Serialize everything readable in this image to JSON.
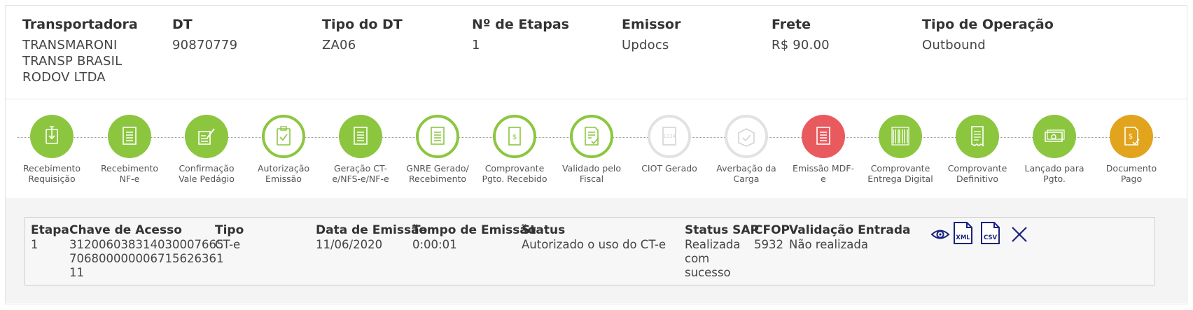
{
  "header": {
    "fields": [
      {
        "label": "Transportadora",
        "value_lines": [
          "TRANSMARONI",
          "TRANSP BRASIL",
          "RODOV LTDA"
        ]
      },
      {
        "label": "DT",
        "value_lines": [
          "90870779"
        ]
      },
      {
        "label": "Tipo do DT",
        "value_lines": [
          "ZA06"
        ]
      },
      {
        "label": "Nº de Etapas",
        "value_lines": [
          "1"
        ]
      },
      {
        "label": "Emissor",
        "value_lines": [
          "Updocs"
        ]
      },
      {
        "label": "Frete",
        "value_lines": [
          "R$ 90.00"
        ]
      },
      {
        "label": "Tipo de Operação",
        "value_lines": [
          "Outbound"
        ]
      }
    ]
  },
  "timeline": {
    "steps": [
      {
        "label1": "Recebimento",
        "label2": "Requisição",
        "state": "fill",
        "icon": "download-doc-icon"
      },
      {
        "label1": "Recebimento",
        "label2": "NF-e",
        "state": "fill",
        "icon": "document-icon"
      },
      {
        "label1": "Confirmação",
        "label2": "Vale Pedágio",
        "state": "fill",
        "icon": "sign-form-icon"
      },
      {
        "label1": "Autorização",
        "label2": "Emissão",
        "state": "outline",
        "icon": "clipboard-check-icon"
      },
      {
        "label1": "Geração CT-",
        "label2": "e/NFS-e/NF-e",
        "state": "fill",
        "icon": "document-icon"
      },
      {
        "label1": "GNRE Gerado/",
        "label2": "Recebimento",
        "state": "outline",
        "icon": "document-icon"
      },
      {
        "label1": "Comprovante",
        "label2": "Pgto. Recebido",
        "state": "outline",
        "icon": "money-doc-icon"
      },
      {
        "label1": "Validado pelo",
        "label2": "Fiscal",
        "state": "outline",
        "icon": "doc-check-icon"
      },
      {
        "label1": "CIOT Gerado",
        "label2": "",
        "state": "grey",
        "icon": "ciot-doc-icon"
      },
      {
        "label1": "Averbação da",
        "label2": "Carga",
        "state": "grey",
        "icon": "box-check-icon"
      },
      {
        "label1": "Emissão MDF-",
        "label2": "e",
        "state": "red",
        "icon": "document-icon"
      },
      {
        "label1": "Comprovante",
        "label2": "Entrega Digital",
        "state": "fill",
        "icon": "barcode-doc-icon"
      },
      {
        "label1": "Comprovante",
        "label2": "Definitivo",
        "state": "fill",
        "icon": "receipt-icon"
      },
      {
        "label1": "Lançado para",
        "label2": "Pgto.",
        "state": "fill",
        "icon": "cash-icon"
      },
      {
        "label1": "Documento",
        "label2": "Pago",
        "state": "orange",
        "icon": "paid-doc-icon"
      }
    ]
  },
  "table": {
    "headers": {
      "etapa": "Etapa",
      "chave": "Chave de Acesso",
      "tipo": "Tipo",
      "data": "Data de Emissão",
      "tempo": "Tempo de Emissão",
      "status": "Status",
      "status_sap": "Status SAP",
      "cfop": "CFOP",
      "validacao": "Validação Entrada"
    },
    "row": {
      "etapa": "1",
      "chave_lines": [
        "312006038314030007665",
        "706800000006715626361",
        "11"
      ],
      "tipo": "CT-e",
      "data": "11/06/2020",
      "tempo": "0:00:01",
      "status": "Autorizado o uso do CT-e",
      "status_sap_lines": [
        "Realizada",
        "com",
        "sucesso"
      ],
      "cfop": "5932",
      "validacao": "Não realizada"
    },
    "actions": [
      {
        "icon": "eye-icon",
        "label": ""
      },
      {
        "icon": "xml-file-icon",
        "label": "XML"
      },
      {
        "icon": "csv-file-icon",
        "label": "CSV"
      },
      {
        "icon": "close-icon",
        "label": ""
      }
    ]
  },
  "colors": {
    "green": "#8cc63f",
    "grey": "#e2e2e2",
    "red": "#e95a5e",
    "orange": "#e2a41c",
    "action_blue": "#1a237e"
  }
}
